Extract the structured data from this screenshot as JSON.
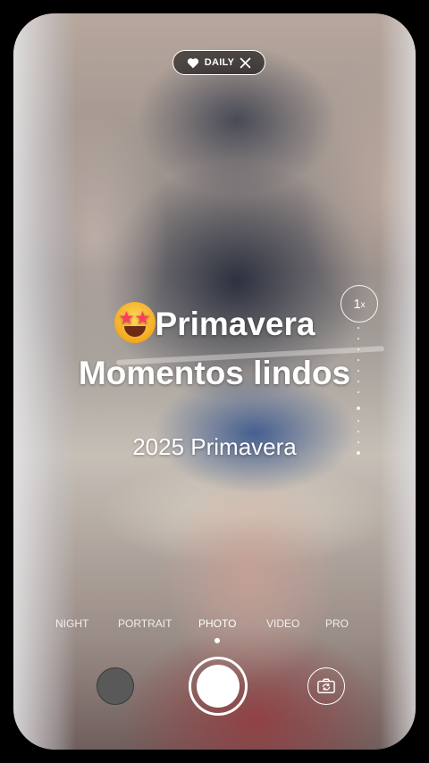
{
  "filter_chip": {
    "label": "DAILY",
    "icon": "heart-icon",
    "close_icon": "close-icon"
  },
  "zoom": {
    "value": "1",
    "unit": "x"
  },
  "overlay": {
    "emoji": "star-struck-emoji-icon",
    "line1": "Primavera",
    "line2": "Momentos lindos",
    "subtitle": "2025 Primavera"
  },
  "modes": [
    {
      "label": "NIGHT"
    },
    {
      "label": "PORTRAIT"
    },
    {
      "label": "PHOTO",
      "active": true
    },
    {
      "label": "VIDEO"
    },
    {
      "label": "PRO"
    }
  ],
  "controls": {
    "gallery": "gallery-thumbnail",
    "shutter": "shutter-icon",
    "flip": "flip-camera-icon"
  }
}
